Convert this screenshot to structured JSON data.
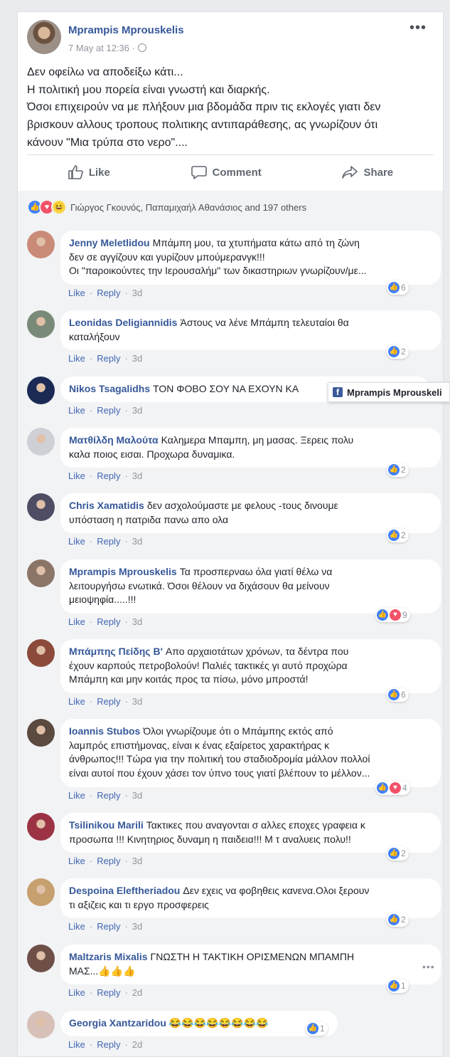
{
  "post": {
    "author": "Mprampis Mprouskelis",
    "timestamp": "7 May at 12:36 ·",
    "more_icon": "more-dots-icon",
    "text_lines": [
      "Δεν οφείλω να αποδείξω κάτι...",
      "Η πολιτική μου πορεία είναι γνωστή και διαρκής.",
      "Όσοι επιχειρούν να με πλήξουν μια βδομάδα πριν τις εκλογές γιατι δεν",
      "βρισκουν αλλους τροπους πολιτικης αντιπαράθεσης, ας γνωρίζουν ότι",
      "κάνουν \"Μια τρύπα στο νερο\"...."
    ],
    "actions": {
      "like": "Like",
      "comment": "Comment",
      "share": "Share"
    }
  },
  "reactions": {
    "text": "Γιώργος Γκουνός, Παπαμιχαήλ Αθανάσιος and 197 others",
    "colors": {
      "like": "#4080ff",
      "love": "#f25268",
      "haha": "#f7d84a"
    }
  },
  "comment_actions": {
    "like": "Like",
    "reply": "Reply"
  },
  "popup": {
    "label": "Mprampis Mprouskeli"
  },
  "comments": [
    {
      "name": "Jenny Meletlidou",
      "lines": [
        "Μπάμπη μου, τα χτυπήματα κάτω από τη ζώνη",
        "δεν σε αγγίζουν και γυρίζουν μπούμερανγκ!!!",
        "Οι \"παροικούντες την Ιερουσαλήμ\" των δικαστηριων γνωρίζουν/με..."
      ],
      "time": "3d",
      "count": "6"
    },
    {
      "name": "Leonidas Deligiannidis",
      "lines": [
        "Άστους να λένε Μπάμπη τελευταίοι θα",
        "καταλήξουν"
      ],
      "time": "3d",
      "count": "2"
    },
    {
      "name": "Nikos Tsagalidhs",
      "lines": [
        "ΤΟΝ ΦΟΒΟ ΣΟΥ ΝΑ ΕΧΟΥΝ ΚΑ"
      ],
      "time": "3d",
      "count": ""
    },
    {
      "name": "Ματθίλδη Μαλούτα",
      "lines": [
        "Καλημερα Μπαμπη, μη μασας. Ξερεις πολυ",
        "καλα ποιος εισαι. Προχωρα δυναμικα."
      ],
      "time": "3d",
      "count": "2"
    },
    {
      "name": "Chris Xamatidis",
      "lines": [
        "δεν ασχολούμαστε με φελους -τους δινουμε",
        "υπόσταση η πατριδα πανω απο ολα"
      ],
      "time": "3d",
      "count": "2"
    },
    {
      "name": "Mprampis Mprouskelis",
      "lines": [
        "Τα προσπερναω όλα γιατί θέλω να",
        "λειτουργήσω ενωτικά. Όσοι θέλουν να διχάσουν θα μείνουν",
        "μειοψηφία.....!!!"
      ],
      "time": "3d",
      "count": "9"
    },
    {
      "name": "Μπάμπης Πείδης Β'",
      "lines": [
        "Απο αρχαιοτάτων χρόνων, τα δέντρα που",
        "έχουν καρπούς πετροβολούν! Παλιές τακτικές γι αυτό προχώρα",
        "Μπάμπη και μην κοιτάς προς τα πίσω, μόνο μπροστά!"
      ],
      "time": "3d",
      "count": "6"
    },
    {
      "name": "Ioannis Stubos",
      "lines": [
        "Όλοι γνωρίζουμε ότι ο Μπάμπης εκτός από",
        "λαμπρός επιστήμονας, είναι κ ένας εξαίρετος χαρακτήρας κ",
        "άνθρωπος!!! Τώρα για την πολιτική του σταδιοδρομία μάλλον πολλοί",
        "είναι αυτοί που έχουν χάσει τον ύπνο τους γιατί βλέπουν το μέλλον..."
      ],
      "time": "3d",
      "count": "4"
    },
    {
      "name": "Tsilinikou Marili",
      "lines": [
        "Τακτικες που αναγονται σ αλλες εποχες γραφεια κ",
        "προσωπα !!! Κινητηριος δυναμη η παιδεια!!! Μ τ αναλυεις πολυ!!"
      ],
      "time": "3d",
      "count": "2"
    },
    {
      "name": "Despoina Eleftheriadou",
      "lines": [
        "Δεν εχεις να φοβηθεις κανενα.Ολοι ξερουν",
        "τι αξιζεις και τι εργο προσφερεις"
      ],
      "time": "3d",
      "count": "2"
    },
    {
      "name": "Maltzaris Mixalis",
      "lines": [
        "ΓΝΩΣΤΗ Η ΤΑΚΤΙΚΗ ΟΡΙΣΜΕΝΩΝ ΜΠΑΜΠΗ",
        "ΜΑΣ...👍👍👍"
      ],
      "time": "2d",
      "count": "1"
    },
    {
      "name": "Georgia Xantzaridou",
      "lines": [
        "😂😂😂😂😂😂😂😂"
      ],
      "time": "2d",
      "count": "1"
    }
  ]
}
